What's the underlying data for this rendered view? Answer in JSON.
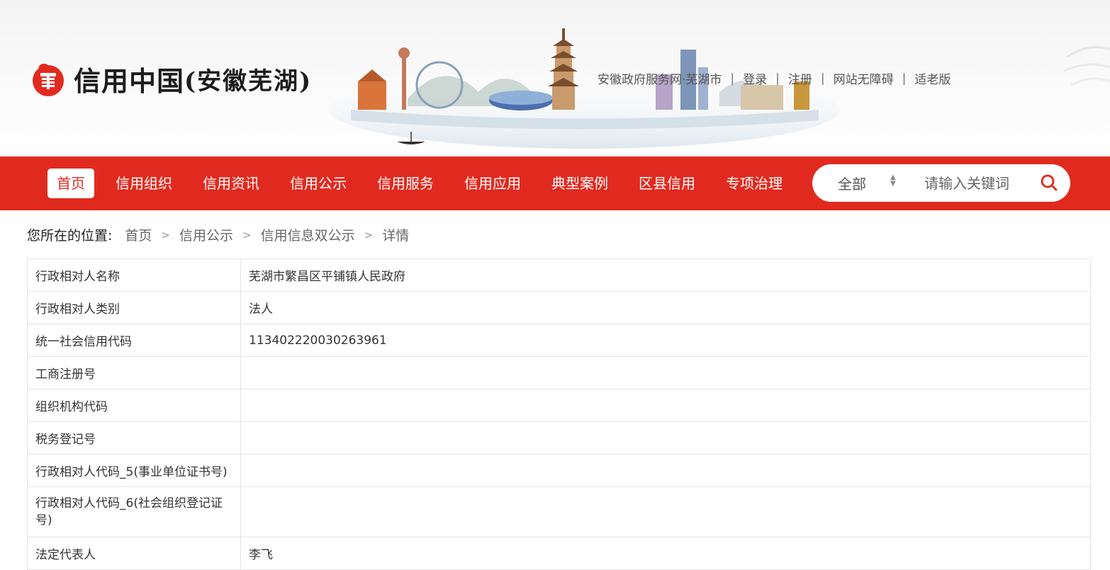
{
  "brand": {
    "title": "信用中国",
    "subtitle": "(安徽芜湖)"
  },
  "toplinks": [
    {
      "label": "安徽政府服务网·芜湖市"
    },
    {
      "label": "登录"
    },
    {
      "label": "注册"
    },
    {
      "label": "网站无障碍"
    },
    {
      "label": "适老版"
    }
  ],
  "nav": {
    "items": [
      {
        "label": "首页",
        "active": true
      },
      {
        "label": "信用组织"
      },
      {
        "label": "信用资讯"
      },
      {
        "label": "信用公示"
      },
      {
        "label": "信用服务"
      },
      {
        "label": "信用应用"
      },
      {
        "label": "典型案例"
      },
      {
        "label": "区县信用"
      },
      {
        "label": "专项治理"
      }
    ]
  },
  "search": {
    "scope": "全部",
    "placeholder": "请输入关键词",
    "icon": "search-icon"
  },
  "breadcrumb": {
    "label": "您所在的位置:",
    "items": [
      "首页",
      "信用公示",
      "信用信息双公示"
    ],
    "current": "详情",
    "separator": ">"
  },
  "details": [
    {
      "key": "行政相对人名称",
      "value": "芜湖市繁昌区平铺镇人民政府"
    },
    {
      "key": "行政相对人类别",
      "value": "法人"
    },
    {
      "key": "统一社会信用代码",
      "value": "113402220030263961"
    },
    {
      "key": "工商注册号",
      "value": ""
    },
    {
      "key": "组织机构代码",
      "value": ""
    },
    {
      "key": "税务登记号",
      "value": ""
    },
    {
      "key": "行政相对人代码_5(事业单位证书号)",
      "value": ""
    },
    {
      "key": "行政相对人代码_6(社会组织登记证号)",
      "value": ""
    },
    {
      "key": "法定代表人",
      "value": "李飞"
    }
  ],
  "colors": {
    "brand_red": "#e12a1f",
    "text": "#333333",
    "border": "#e4e4e4"
  }
}
